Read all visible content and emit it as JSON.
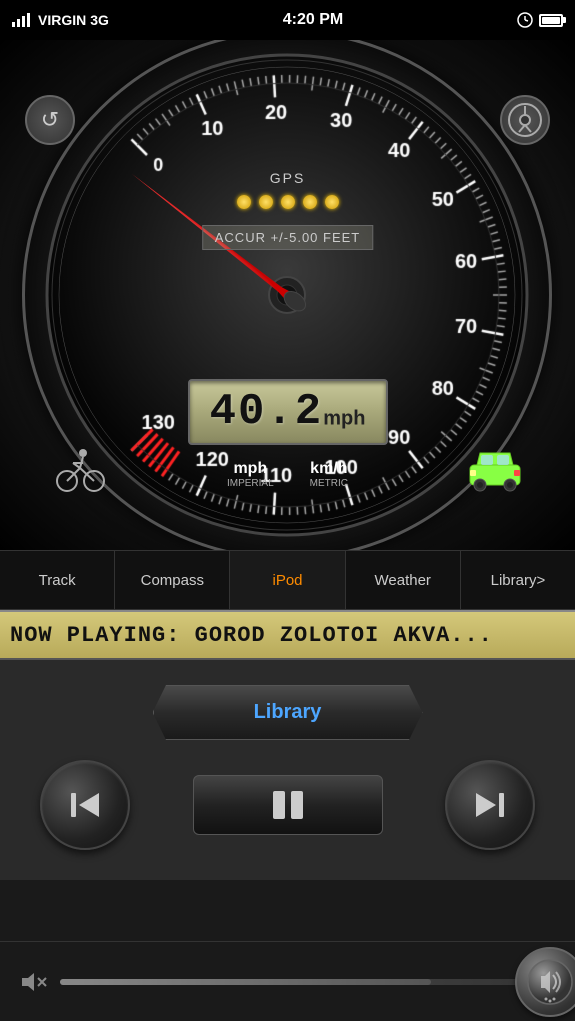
{
  "status_bar": {
    "carrier": "VIRGIN",
    "network": "3G",
    "time": "4:20 PM"
  },
  "speedometer": {
    "reset_icon": "↺",
    "settings_icon": "⚙",
    "gps_label": "GPS",
    "accuracy_text": "ACCUR +/-5.00 FEET",
    "speed_value": "40.2",
    "speed_unit": "mph",
    "units": [
      {
        "main": "mph",
        "sub": "IMPERIAL",
        "active": true
      },
      {
        "main": "km/h",
        "sub": "METRIC",
        "active": false
      }
    ],
    "gps_dots_count": 5
  },
  "tabs": [
    {
      "label": "Track",
      "active": false
    },
    {
      "label": "Compass",
      "active": false
    },
    {
      "label": "iPod",
      "active": true
    },
    {
      "label": "Weather",
      "active": false
    },
    {
      "label": "Library>",
      "active": false
    }
  ],
  "now_playing": {
    "text": "NOW PLAYING: GOROD ZOLOTOI AKVA..."
  },
  "ipod_controls": {
    "library_label": "Library",
    "prev_icon": "⏮",
    "pause_icon": "⏸",
    "next_icon": "⏭",
    "pause_rect_icon": "⏸"
  },
  "volume": {
    "mute_icon": "🔇",
    "volume_icon": "🔊"
  }
}
